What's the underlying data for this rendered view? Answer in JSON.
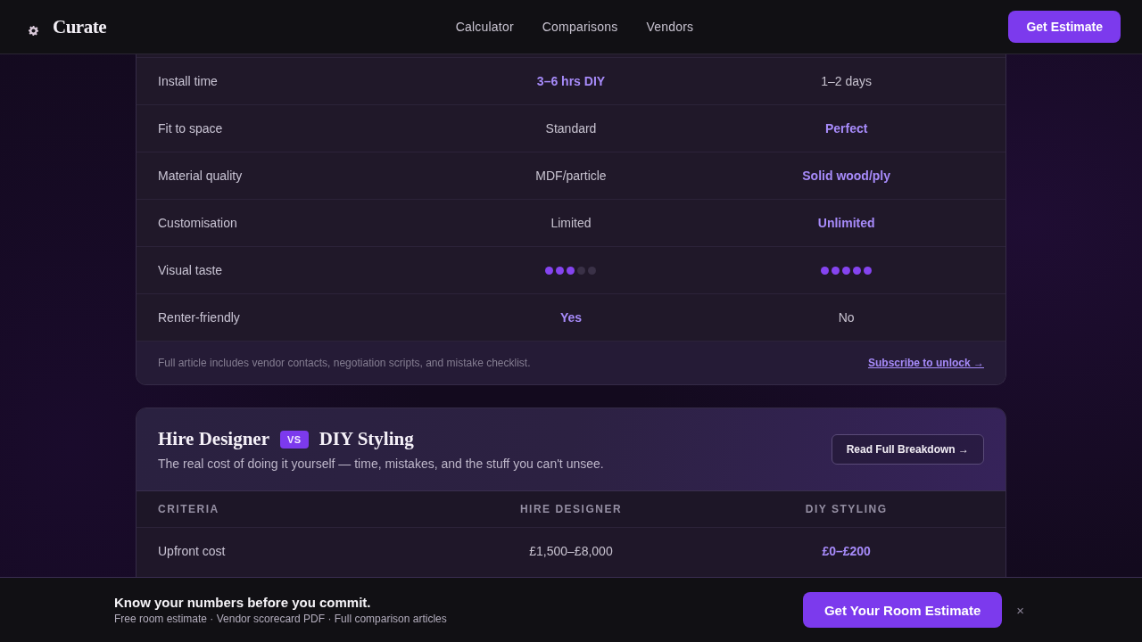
{
  "header": {
    "logo": "Curate",
    "nav": [
      {
        "label": "Calculator"
      },
      {
        "label": "Comparisons"
      },
      {
        "label": "Vendors"
      }
    ],
    "cta": "Get Estimate"
  },
  "comparisons": [
    {
      "rows": [
        {
          "kind": "text",
          "label": "Install time",
          "cells": [
            {
              "text": "3–6 hrs DIY",
              "highlighted": true
            },
            {
              "text": "1–2 days",
              "highlighted": false
            }
          ]
        },
        {
          "kind": "text",
          "label": "Fit to space",
          "cells": [
            {
              "text": "Standard",
              "highlighted": false
            },
            {
              "text": "Perfect",
              "highlighted": true
            }
          ]
        },
        {
          "kind": "text",
          "label": "Material quality",
          "cells": [
            {
              "text": "MDF/particle",
              "highlighted": false
            },
            {
              "text": "Solid wood/ply",
              "highlighted": true
            }
          ]
        },
        {
          "kind": "text",
          "label": "Customisation",
          "cells": [
            {
              "text": "Limited",
              "highlighted": false
            },
            {
              "text": "Unlimited",
              "highlighted": true
            }
          ]
        },
        {
          "kind": "rating",
          "label": "Visual taste",
          "cells": [
            {
              "stars": 3
            },
            {
              "stars": 5
            }
          ]
        },
        {
          "kind": "text",
          "label": "Renter-friendly",
          "cells": [
            {
              "text": "Yes",
              "highlighted": true
            },
            {
              "text": "No",
              "highlighted": false
            }
          ]
        }
      ],
      "footer": {
        "note": "Full article includes vendor contacts, negotiation scripts, and mistake checklist.",
        "link": "Subscribe to unlock →"
      }
    },
    {
      "title_left": "Hire Designer",
      "vs": "VS",
      "title_right": "DIY Styling",
      "subtitle": "The real cost of doing it yourself — time, mistakes, and the stuff you can't unsee.",
      "button": "Read Full Breakdown →",
      "label_header": "CRITERIA",
      "columns": [
        "HIRE DESIGNER",
        "DIY STYLING"
      ],
      "rows": [
        {
          "kind": "text",
          "label": "Upfront cost",
          "cells": [
            {
              "text": "£1,500–£8,000",
              "highlighted": false
            },
            {
              "text": "£0–£200",
              "highlighted": true
            }
          ]
        }
      ]
    }
  ],
  "banner": {
    "title": "Know your numbers before you commit.",
    "subtitle": "Free room estimate · Vendor scorecard PDF · Full comparison articles",
    "button": "Get Your Room Estimate",
    "close": "×"
  }
}
